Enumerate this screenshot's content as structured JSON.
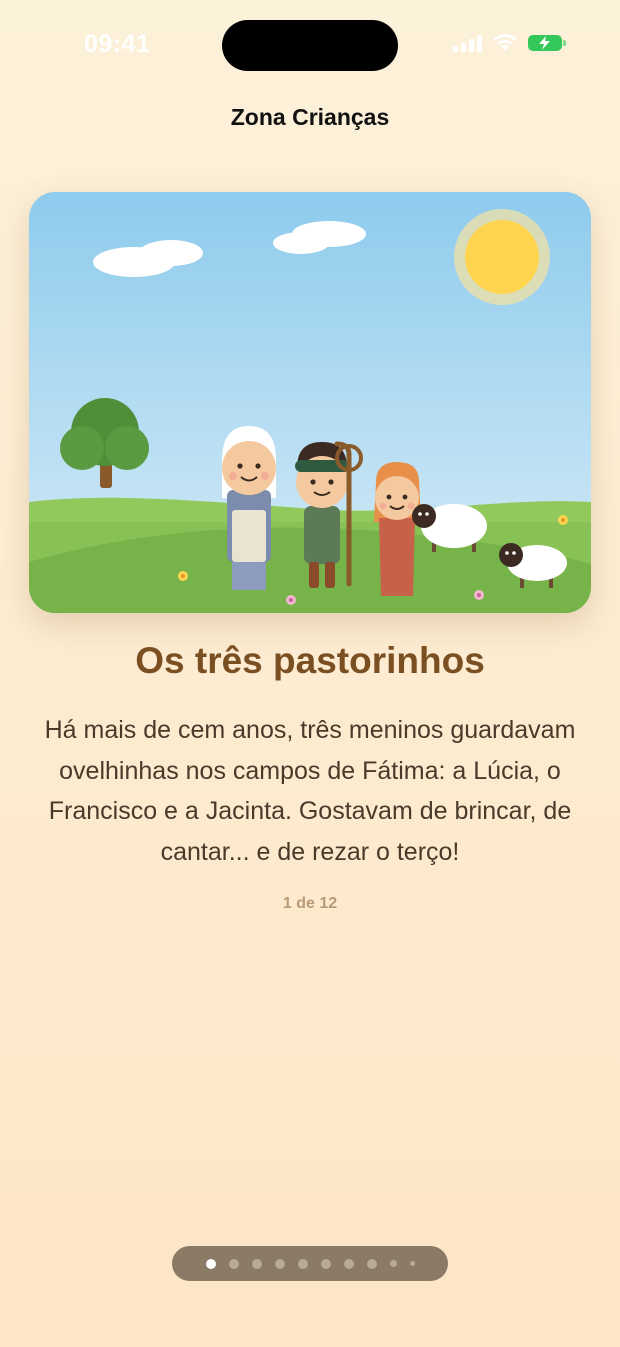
{
  "status_bar": {
    "time": "09:41"
  },
  "header": {
    "title": "Zona Crianças"
  },
  "story": {
    "title": "Os três pastorinhos",
    "body": "Há mais de cem anos, três meninos guardavam ovelhinhas nos campos de Fátima: a Lúcia, o Francisco e a Jacinta. Gostavam de brincar, de cantar... e de rezar o terço!",
    "counter": "1 de 12",
    "current_page": 1,
    "total_pages": 12
  },
  "pager": {
    "visible_dots": 10,
    "active_index": 0
  },
  "colors": {
    "sky_top": "#8ecbed",
    "grass": "#7dba4e",
    "title_brown": "#7a4f22",
    "sun": "#ffd54f"
  }
}
